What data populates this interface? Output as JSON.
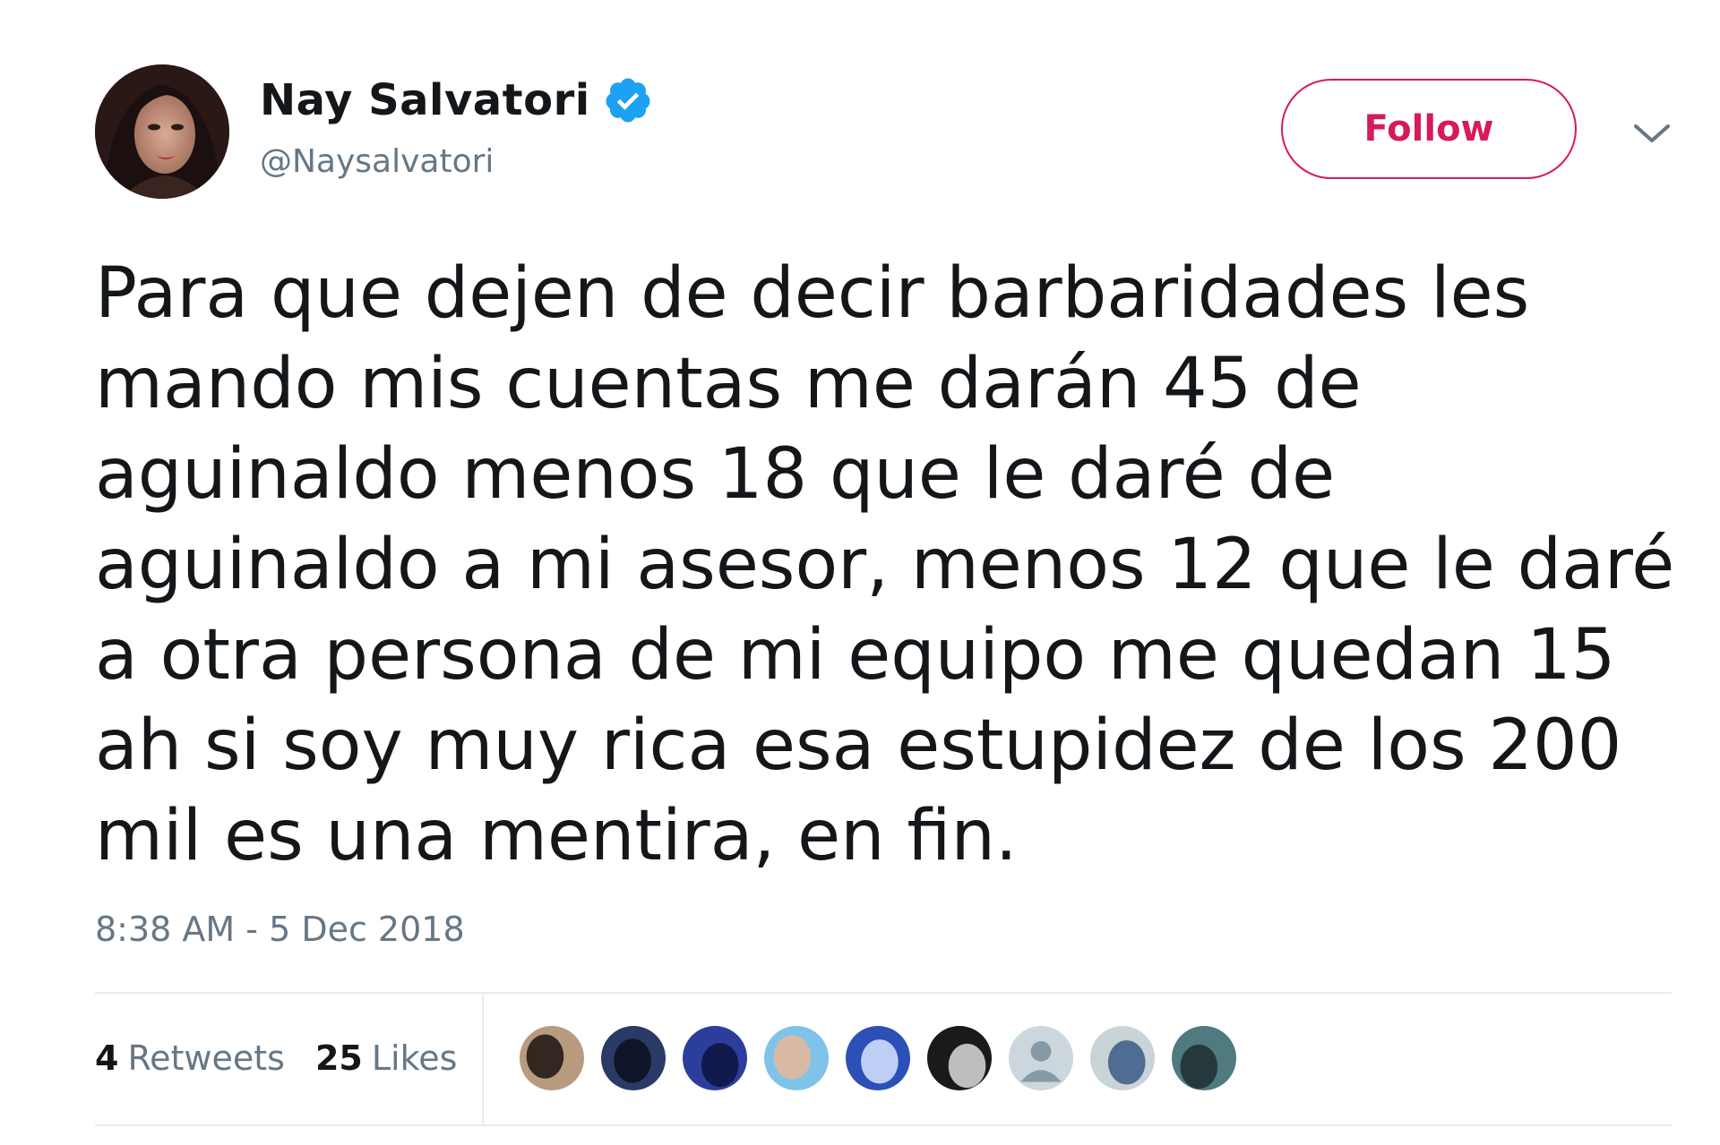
{
  "author": {
    "display_name": "Nay Salvatori",
    "handle": "@Naysalvatori",
    "verified": true,
    "avatar_icon": "profile-photo-woman"
  },
  "follow_button": {
    "label": "Follow"
  },
  "menu": {
    "icon": "chevron-down-icon"
  },
  "tweet": {
    "text": "Para que dejen de decir barbaridades les mando mis cuentas me darán 45 de aguinaldo menos 18 que le daré de aguinaldo a mi asesor, menos 12 que le daré a otra persona de mi equipo me quedan 15 ah si soy muy rica esa estupidez de los 200 mil es una mentira, en fin.",
    "timestamp": "8:38 AM - 5 Dec 2018"
  },
  "stats": {
    "retweets": {
      "count": "4",
      "label": "Retweets"
    },
    "likes": {
      "count": "25",
      "label": "Likes"
    }
  },
  "likers": [
    {
      "icon": "liker-avatar-1",
      "colors": [
        "#b89a7e",
        "#1a1410"
      ]
    },
    {
      "icon": "liker-avatar-2",
      "colors": [
        "#2a3a66",
        "#0b0f1e"
      ]
    },
    {
      "icon": "liker-avatar-3",
      "colors": [
        "#2c3e9c",
        "#0d1440"
      ]
    },
    {
      "icon": "liker-avatar-4",
      "colors": [
        "#7fc3e8",
        "#e8b898"
      ]
    },
    {
      "icon": "liker-avatar-5",
      "colors": [
        "#2c4fb8",
        "#d8e4ff"
      ]
    },
    {
      "icon": "liker-avatar-6",
      "colors": [
        "#1a1a1a",
        "#dcdcdc"
      ]
    },
    {
      "icon": "default-avatar",
      "colors": [
        "#ccd6dd",
        "#8899a6"
      ]
    },
    {
      "icon": "liker-avatar-8",
      "colors": [
        "#c9d3d8",
        "#3a5a86"
      ]
    },
    {
      "icon": "liker-avatar-9",
      "colors": [
        "#4e7a80",
        "#1e2e30"
      ]
    }
  ],
  "colors": {
    "accent": "#d51b5a",
    "verified_blue": "#1da1f2",
    "text_primary": "#14171a",
    "text_secondary": "#657786",
    "divider": "#e6ecf0"
  }
}
